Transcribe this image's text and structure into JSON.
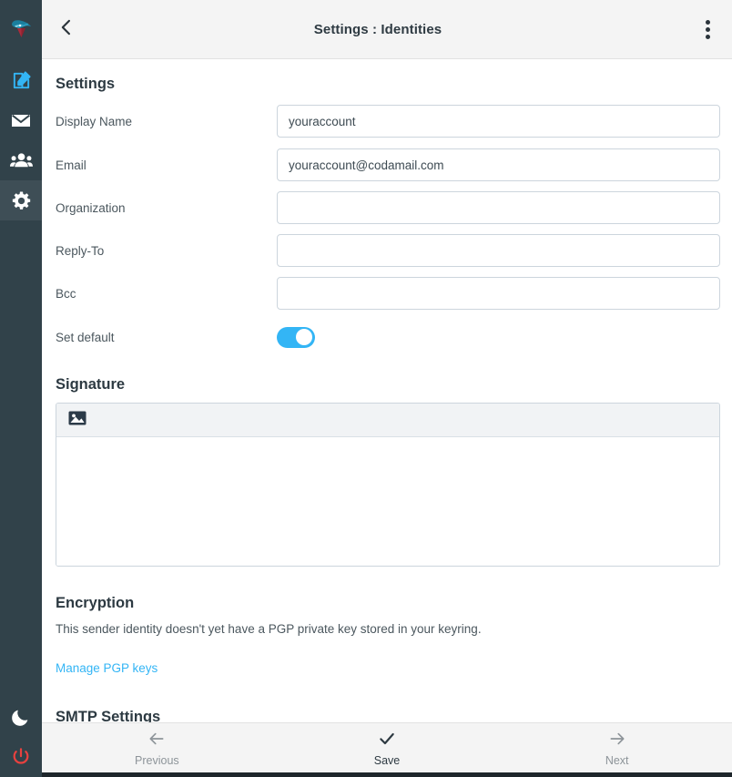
{
  "sidebar": {
    "background_color": "#31424a",
    "accent_color": "#33b5f5",
    "items": [
      {
        "name": "app-logo",
        "icon": "codamail-logo-icon",
        "label": ""
      },
      {
        "name": "compose",
        "icon": "compose-pencil-icon",
        "label": ""
      },
      {
        "name": "mail",
        "icon": "envelope-icon",
        "label": ""
      },
      {
        "name": "contacts",
        "icon": "people-icon",
        "label": ""
      },
      {
        "name": "settings",
        "icon": "gear-icon",
        "label": "",
        "active": true
      }
    ],
    "bottom_items": [
      {
        "name": "dark-mode",
        "icon": "moon-icon",
        "label": ""
      },
      {
        "name": "logout",
        "icon": "power-icon",
        "label": "",
        "color": "#e8413f"
      }
    ]
  },
  "header": {
    "back_icon": "chevron-left-icon",
    "title": "Settings : Identities",
    "more_icon": "dots-vertical-icon",
    "background_color": "#f4f4f4"
  },
  "main": {
    "settings_section": {
      "heading": "Settings",
      "fields": [
        {
          "label": "Display Name",
          "value": "youraccount",
          "placeholder": ""
        },
        {
          "label": "Email",
          "value": "youraccount@codamail.com",
          "placeholder": ""
        },
        {
          "label": "Organization",
          "value": "",
          "placeholder": ""
        },
        {
          "label": "Reply-To",
          "value": "",
          "placeholder": ""
        },
        {
          "label": "Bcc",
          "value": "",
          "placeholder": ""
        }
      ],
      "toggle": {
        "label": "Set default",
        "state": "on",
        "on_color": "#33b5f5"
      }
    },
    "signature_section": {
      "heading": "Signature",
      "toolbar_icon": "insert-image-icon",
      "content": "",
      "placeholder": ""
    },
    "encryption_section": {
      "heading": "Encryption",
      "message": "This sender identity doesn't yet have a PGP private key stored in your keyring.",
      "link_label": "Manage PGP keys",
      "link_color": "#33b5f5"
    },
    "smtp_section": {
      "heading": "SMTP Settings"
    }
  },
  "footer": {
    "buttons": [
      {
        "name": "previous",
        "icon": "arrow-left-icon",
        "label": "Previous",
        "enabled": false
      },
      {
        "name": "save",
        "icon": "check-icon",
        "label": "Save",
        "enabled": true
      },
      {
        "name": "next",
        "icon": "arrow-right-icon",
        "label": "Next",
        "enabled": false
      }
    ]
  }
}
